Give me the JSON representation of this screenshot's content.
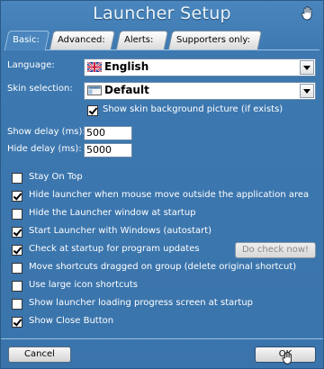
{
  "window": {
    "title": "Launcher Setup"
  },
  "tabs": [
    {
      "label": "Basic:",
      "active": true
    },
    {
      "label": "Advanced:"
    },
    {
      "label": "Alerts:"
    },
    {
      "label": "Supporters only:"
    }
  ],
  "basic": {
    "language_label": "Language:",
    "language_value": "English",
    "skin_label": "Skin selection:",
    "skin_value": "Default",
    "show_skin_bg": {
      "label": "Show skin background picture (if exists)",
      "checked": true
    },
    "show_delay_label": "Show delay (ms):",
    "show_delay_value": "500",
    "hide_delay_label": "Hide delay (ms):",
    "hide_delay_value": "5000",
    "options": [
      {
        "label": "Stay On Top",
        "checked": false
      },
      {
        "label": "Hide launcher when mouse move outside the application area",
        "checked": true
      },
      {
        "label": "Hide the Launcher window at startup",
        "checked": false
      },
      {
        "label": "Start Launcher with Windows (autostart)",
        "checked": true
      },
      {
        "label": "Check at startup for program updates",
        "checked": true
      },
      {
        "label": "Move shortcuts dragged on group (delete original shortcut)",
        "checked": false
      },
      {
        "label": "Use large icon shortcuts",
        "checked": false
      },
      {
        "label": "Show launcher loading progress screen at startup",
        "checked": false
      },
      {
        "label": "Show Close Button",
        "checked": true
      }
    ],
    "do_check_now": "Do check now!"
  },
  "footer": {
    "cancel": "Cancel",
    "ok": "OK"
  },
  "icons": {
    "title_icon": "hand-icon",
    "language_icon": "uk-flag-icon",
    "skin_icon": "skin-icon"
  }
}
